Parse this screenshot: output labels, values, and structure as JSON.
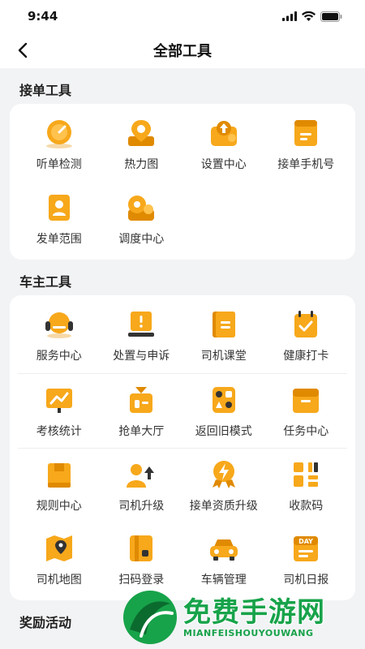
{
  "status_bar": {
    "time": "9:44",
    "icons": [
      "signal-icon",
      "wifi-icon",
      "battery-icon"
    ]
  },
  "nav": {
    "title": "全部工具",
    "back_icon": "chevron-left-icon"
  },
  "sections": {
    "order": {
      "title": "接单工具"
    },
    "owner": {
      "title": "车主工具"
    },
    "reward": {
      "title": "奖励活动"
    }
  },
  "order_tools": [
    {
      "label": "听单检测",
      "icon": "gauge-icon"
    },
    {
      "label": "热力图",
      "icon": "location-pin-icon"
    },
    {
      "label": "设置中心",
      "icon": "settings-icon"
    },
    {
      "label": "接单手机号",
      "icon": "phone-card-icon"
    },
    {
      "label": "发单范围",
      "icon": "person-card-icon"
    },
    {
      "label": "调度中心",
      "icon": "dispatch-icon"
    }
  ],
  "owner_tools": [
    {
      "label": "服务中心",
      "icon": "headset-icon"
    },
    {
      "label": "处置与申诉",
      "icon": "alert-screen-icon"
    },
    {
      "label": "司机课堂",
      "icon": "book-icon"
    },
    {
      "label": "健康打卡",
      "icon": "calendar-check-icon"
    },
    {
      "label": "考核统计",
      "icon": "chart-board-icon"
    },
    {
      "label": "抢单大厅",
      "icon": "grab-order-icon"
    },
    {
      "label": "返回旧模式",
      "icon": "mode-switch-icon"
    },
    {
      "label": "任务中心",
      "icon": "task-folder-icon"
    },
    {
      "label": "规则中心",
      "icon": "rule-box-icon"
    },
    {
      "label": "司机升级",
      "icon": "upgrade-icon"
    },
    {
      "label": "接单资质升级",
      "icon": "badge-bolt-icon"
    },
    {
      "label": "收款码",
      "icon": "qr-code-icon"
    },
    {
      "label": "司机地图",
      "icon": "map-icon"
    },
    {
      "label": "扫码登录",
      "icon": "scan-login-icon"
    },
    {
      "label": "车辆管理",
      "icon": "car-icon"
    },
    {
      "label": "司机日报",
      "icon": "day-report-icon"
    }
  ],
  "watermark": {
    "title": "免费手游网",
    "subtitle": "MIANFEISHOUYOUWANG"
  },
  "colors": {
    "accent": "#f7a81b",
    "accent_dark": "#e08a00",
    "watermark_green": "#17a34a"
  }
}
